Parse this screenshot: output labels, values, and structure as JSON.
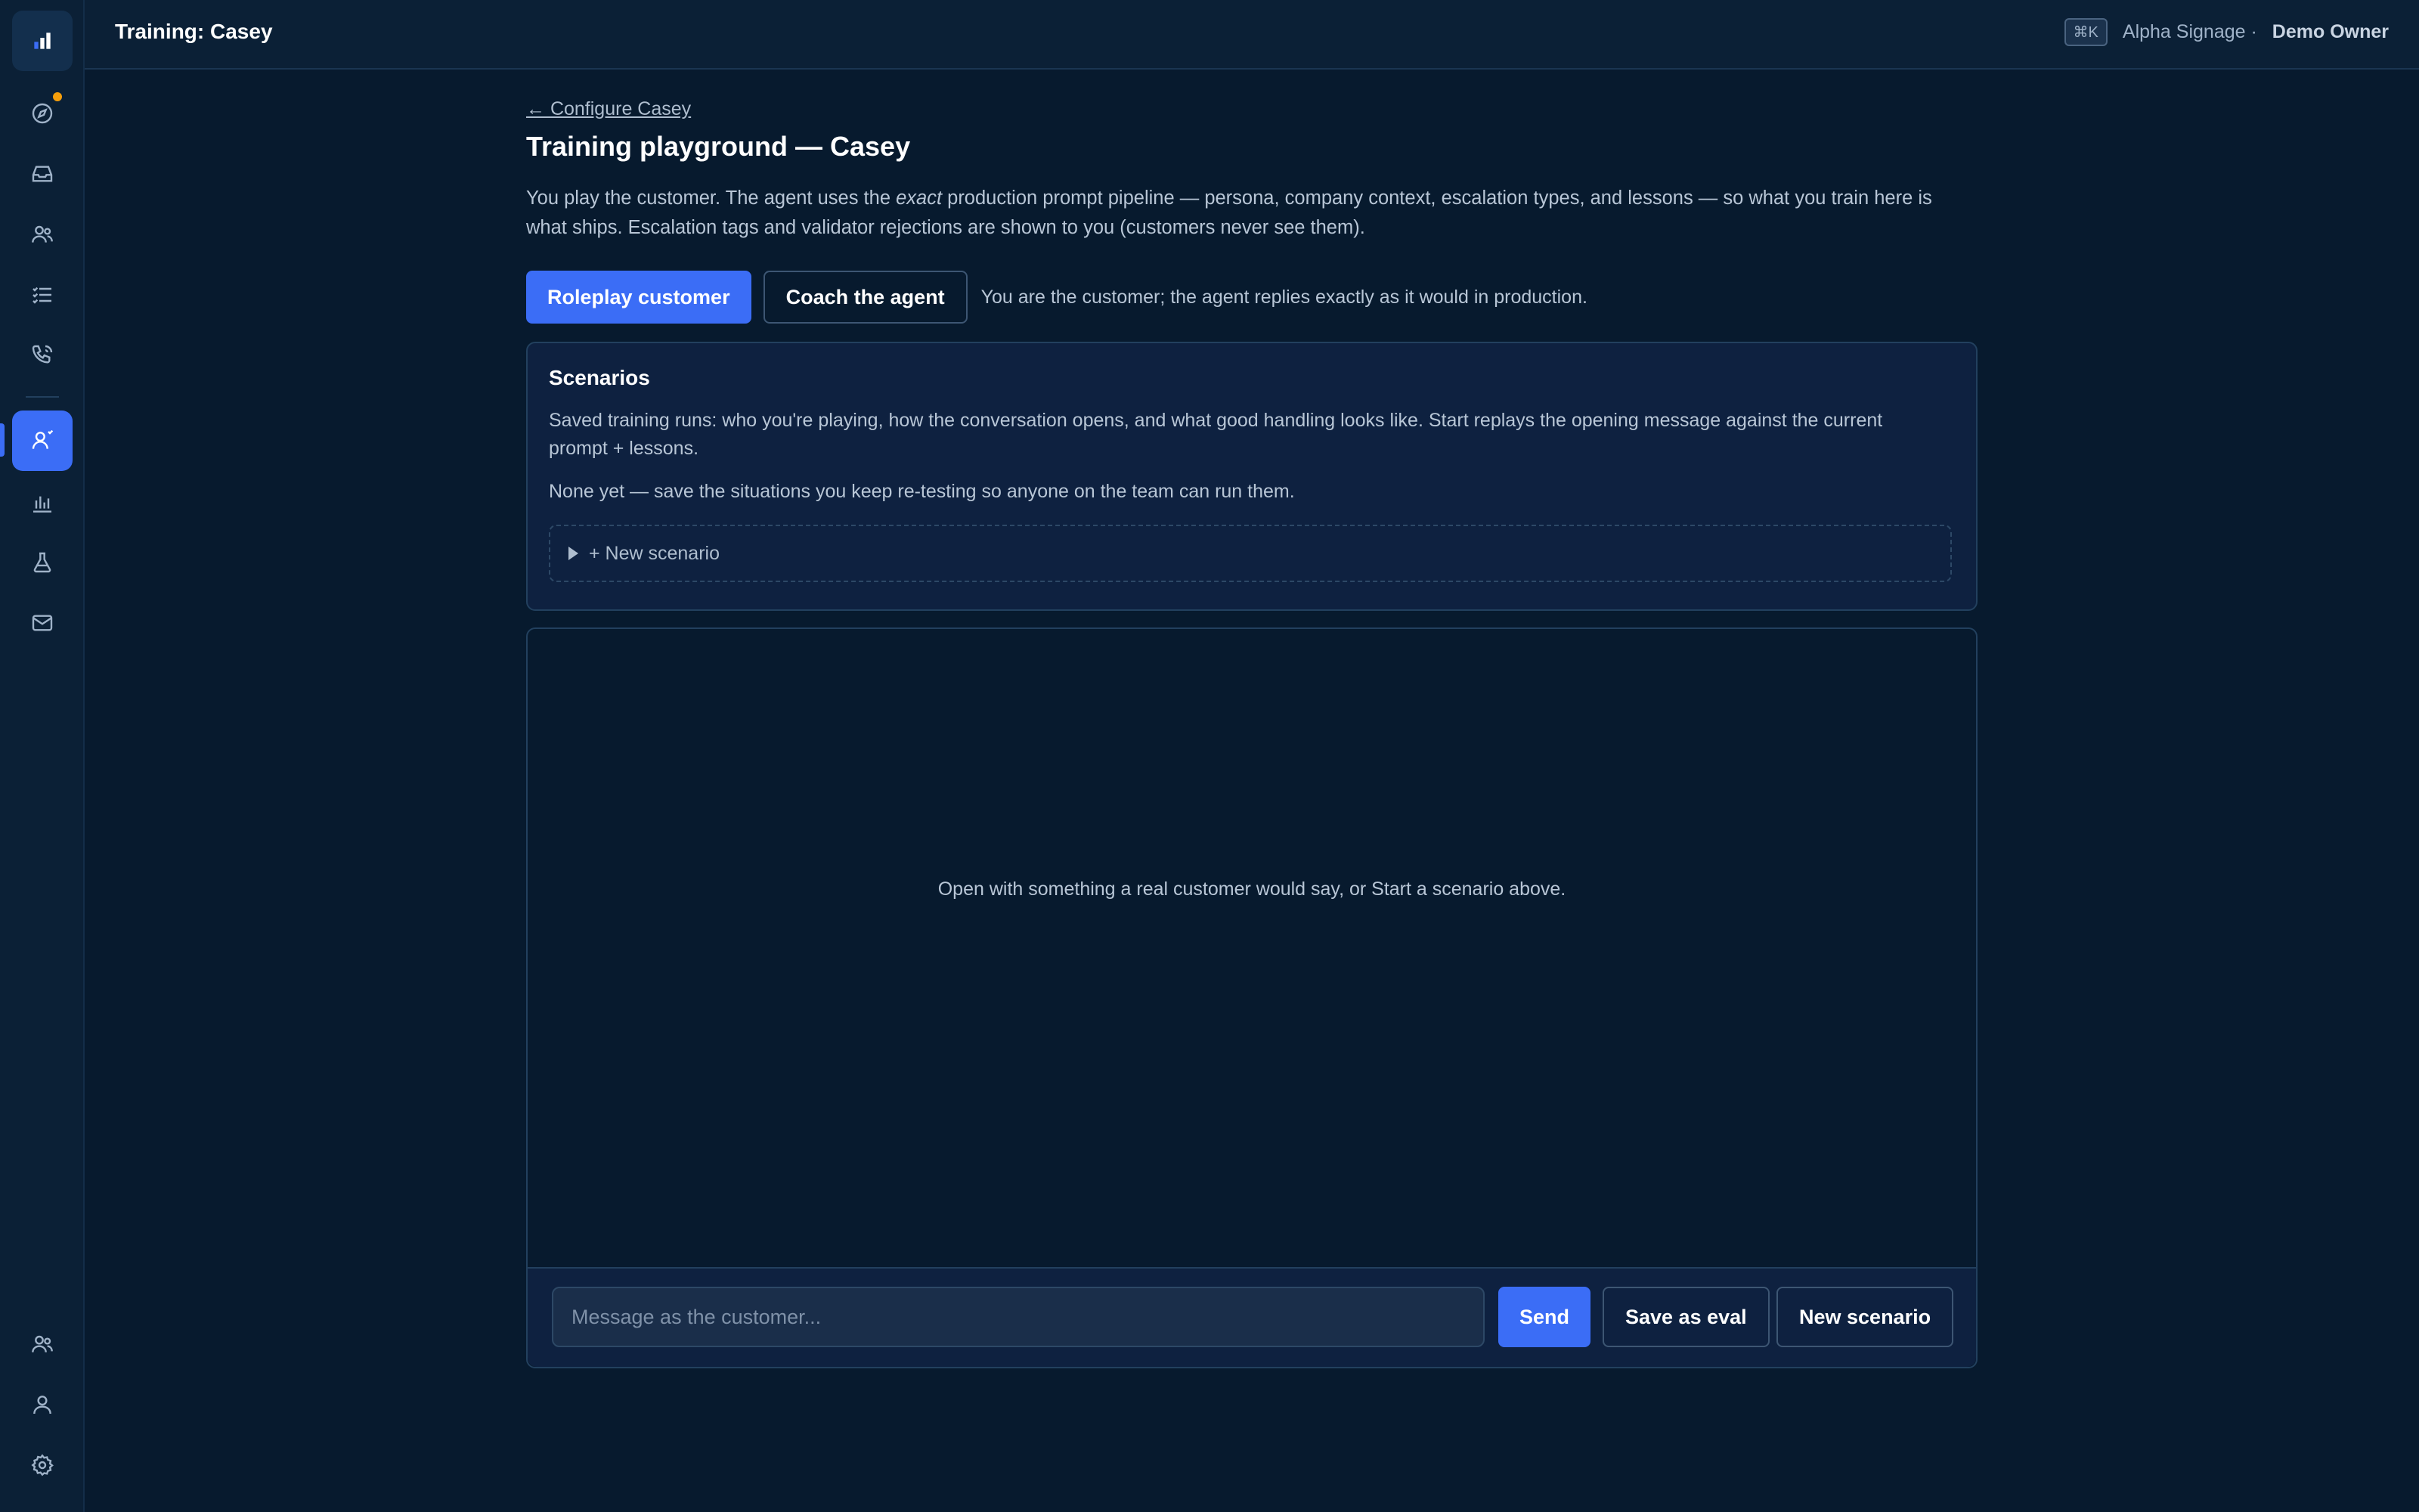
{
  "header": {
    "title": "Training: Casey",
    "shortcut": "⌘K",
    "org": "Alpha Signage ·",
    "user": "Demo Owner"
  },
  "sidebar": {
    "items": [
      {
        "icon": "bar-chart-logo-icon"
      },
      {
        "icon": "compass-icon",
        "badge": true
      },
      {
        "icon": "inbox-icon"
      },
      {
        "icon": "users-icon"
      },
      {
        "icon": "list-checks-icon"
      },
      {
        "icon": "phone-call-icon"
      },
      {
        "icon": "user-training-icon",
        "active": true
      },
      {
        "icon": "analytics-icon"
      },
      {
        "icon": "flask-icon"
      },
      {
        "icon": "mail-icon"
      },
      {
        "icon": "team-icon"
      },
      {
        "icon": "user-icon"
      },
      {
        "icon": "settings-icon"
      }
    ],
    "accent": "#3b6df6",
    "badge_color": "#f59e0b"
  },
  "page": {
    "back_link": "← Configure Casey",
    "title": "Training playground — Casey",
    "intro_before": "You play the customer. The agent uses the ",
    "intro_em": "exact",
    "intro_after": " production prompt pipeline — persona, company context, escalation types, and lessons — so what you train here is what ships. Escalation tags and validator rejections are shown to you (customers never see them)."
  },
  "modes": {
    "roleplay_label": "Roleplay customer",
    "coach_label": "Coach the agent",
    "description": "You are the customer; the agent replies exactly as it would in production."
  },
  "scenarios": {
    "title": "Scenarios",
    "description": "Saved training runs: who you're playing, how the conversation opens, and what good handling looks like. Start replays the opening message against the current prompt + lessons.",
    "empty_text": "None yet — save the situations you keep re-testing so anyone on the team can run them.",
    "new_label": "+ New scenario"
  },
  "chat": {
    "empty_text": "Open with something a real customer would say, or Start a scenario above.",
    "input_placeholder": "Message as the customer...",
    "send_label": "Send",
    "save_eval_label": "Save as eval",
    "new_scenario_label": "New scenario"
  }
}
